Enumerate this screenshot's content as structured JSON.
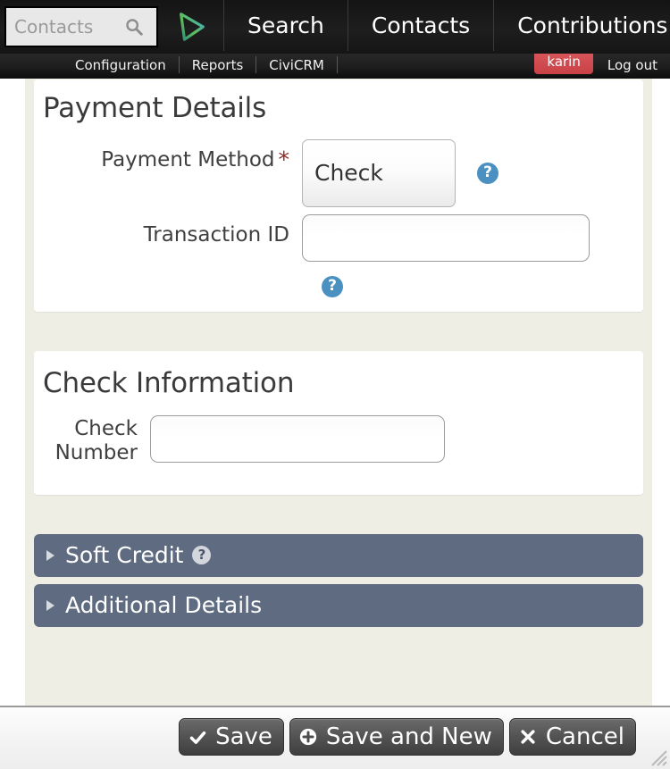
{
  "topbar": {
    "search": {
      "placeholder": "Contacts",
      "value": "",
      "icon": "search-icon"
    },
    "logo": {
      "icon": "civicrm-play-triangle-logo"
    },
    "nav": [
      {
        "label": "Search"
      },
      {
        "label": "Contacts"
      },
      {
        "label": "Contributions"
      }
    ]
  },
  "adminbar": {
    "items": [
      {
        "label": "Configuration"
      },
      {
        "label": "Reports"
      },
      {
        "label": "CiviCRM"
      }
    ],
    "user": "karin",
    "logout": "Log out",
    "user_chip_color": "#c94146"
  },
  "payment_details": {
    "title": "Payment Details",
    "payment_method": {
      "label": "Payment Method",
      "required_marker": "*",
      "value": "Check",
      "help": "?"
    },
    "transaction_id": {
      "label": "Transaction ID",
      "value": "",
      "placeholder": "",
      "help": "?"
    }
  },
  "check_information": {
    "title": "Check Information",
    "check_number": {
      "label_line1": "Check",
      "label_line2": "Number",
      "value": "",
      "placeholder": ""
    }
  },
  "accordions": [
    {
      "label": "Soft Credit",
      "has_help": true,
      "help": "?"
    },
    {
      "label": "Additional Details",
      "has_help": false,
      "help": ""
    }
  ],
  "footer": {
    "buttons": [
      {
        "label": "Save",
        "icon": "check-icon",
        "glyph": "✔"
      },
      {
        "label": "Save and New",
        "icon": "plus-circle-icon",
        "glyph": "⊕"
      },
      {
        "label": "Cancel",
        "icon": "close-x-icon",
        "glyph": "✖"
      }
    ]
  },
  "colors": {
    "accordion_bg": "#5e6b80",
    "container_bg": "#eeeee4",
    "help_blue": "#4a90c0",
    "required_red": "#8b2b28",
    "button_dark": "#4d4d4d"
  }
}
